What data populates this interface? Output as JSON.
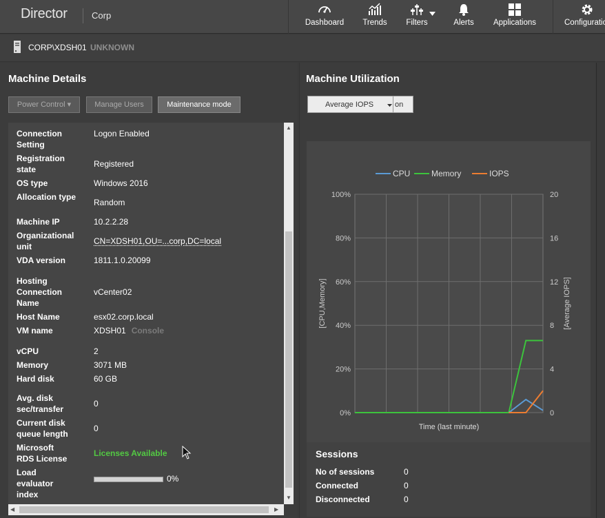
{
  "app": {
    "name": "Director",
    "site": "Corp"
  },
  "nav": [
    {
      "label": "Dashboard",
      "icon": "gauge-icon"
    },
    {
      "label": "Trends",
      "icon": "trend-chart-icon"
    },
    {
      "label": "Filters",
      "icon": "filter-icon"
    },
    {
      "label": "Alerts",
      "icon": "bell-icon"
    },
    {
      "label": "Applications",
      "icon": "grid-icon"
    },
    {
      "label": "Configuration",
      "icon": "gear-icon"
    }
  ],
  "machine": {
    "name": "CORP\\XDSH01",
    "state": "UNKNOWN"
  },
  "details": {
    "title": "Machine Details",
    "buttons": {
      "power": "Power Control ▾",
      "manage": "Manage Users",
      "maintenance": "Maintenance mode"
    },
    "rows": [
      {
        "k": "Connection Setting",
        "v": "Logon Enabled"
      },
      {
        "k": "Registration state",
        "v": "Registered"
      },
      {
        "k": "OS type",
        "v": "Windows 2016"
      },
      {
        "k": "Allocation type",
        "v": "Random"
      },
      {
        "k": "Machine IP",
        "v": "10.2.2.28"
      },
      {
        "k": "Organizational unit",
        "v": "CN=XDSH01,OU=...corp,DC=local"
      },
      {
        "k": "VDA version",
        "v": "1811.1.0.20099"
      },
      {
        "k": "Hosting Connection Name",
        "v": "vCenter02"
      },
      {
        "k": "Host Name",
        "v": "esx02.corp.local"
      },
      {
        "k": "VM name",
        "v": "XDSH01",
        "extra": "Console"
      },
      {
        "k": "vCPU",
        "v": "2"
      },
      {
        "k": "Memory",
        "v": "3071 MB"
      },
      {
        "k": "Hard disk",
        "v": "60 GB"
      },
      {
        "k": "Avg. disk sec/transfer",
        "v": "0"
      },
      {
        "k": "Current disk queue length",
        "v": "0"
      },
      {
        "k": "Microsoft RDS License",
        "v": "Licenses Available"
      },
      {
        "k": "Load evaluator index",
        "v": "0%",
        "level": 0
      }
    ]
  },
  "utilization": {
    "title": "Machine Utilization",
    "metric_select": "Average IOPS",
    "metric_btn": "on"
  },
  "chart_data": {
    "type": "line",
    "legend": [
      "CPU",
      "Memory",
      "IOPS"
    ],
    "colors": {
      "CPU": "#5b9bd5",
      "Memory": "#3cc43c",
      "IOPS": "#ed7d31"
    },
    "legend_position": "top",
    "xlabel": "Time (last minute)",
    "ylabel": "[CPU,Memory]",
    "y2label": "[Average IOPS]",
    "yticks": [
      "100%",
      "80%",
      "60%",
      "40%",
      "20%",
      "0%"
    ],
    "y2ticks": [
      "20",
      "16",
      "12",
      "8",
      "4",
      "0"
    ],
    "ylim": [
      0,
      100
    ],
    "y2lim": [
      0,
      20
    ],
    "grid": true,
    "x": [
      0,
      1,
      2,
      3,
      4,
      5,
      6,
      7,
      8,
      9,
      10,
      11
    ],
    "series": [
      {
        "name": "Memory",
        "axis": "left",
        "values": [
          0,
          0,
          0,
          0,
          0,
          0,
          0,
          0,
          0,
          0,
          33,
          33
        ]
      },
      {
        "name": "CPU",
        "axis": "left",
        "values": [
          null,
          null,
          null,
          null,
          null,
          null,
          null,
          null,
          null,
          0,
          6,
          1
        ]
      },
      {
        "name": "IOPS",
        "axis": "right",
        "values": [
          null,
          null,
          null,
          null,
          null,
          null,
          null,
          null,
          null,
          0,
          0,
          2
        ]
      }
    ]
  },
  "sessions": {
    "title": "Sessions",
    "rows": [
      {
        "k": "No of sessions",
        "v": "0"
      },
      {
        "k": "Connected",
        "v": "0"
      },
      {
        "k": "Disconnected",
        "v": "0"
      }
    ]
  }
}
